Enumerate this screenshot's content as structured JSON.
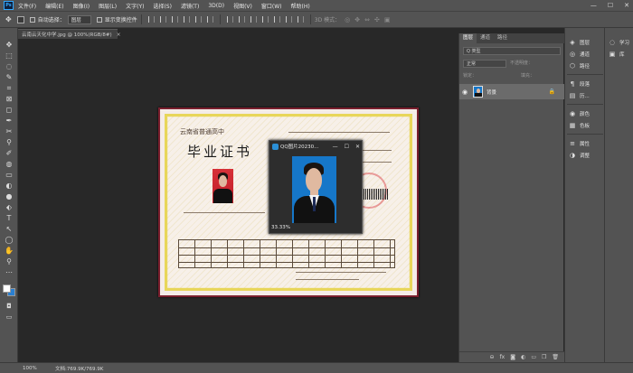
{
  "app": {
    "logo": "Ps"
  },
  "menu": [
    "文件(F)",
    "编辑(E)",
    "图像(I)",
    "图层(L)",
    "文字(Y)",
    "选择(S)",
    "滤镜(T)",
    "3D(D)",
    "视图(V)",
    "窗口(W)",
    "帮助(H)"
  ],
  "window_controls": {
    "minimize": "—",
    "maximize": "☐",
    "close": "✕"
  },
  "options_bar": {
    "auto_select_label": "自动选择：",
    "auto_select_value": "图层",
    "show_transform_label": "显示变换控件",
    "mode_label": "3D 模式："
  },
  "document_tab": {
    "title": "云南云天化中学.jpg @ 100%(RGB/8#)",
    "close": "×"
  },
  "toolbar": {
    "tools": [
      "✥",
      "⬚",
      "◌",
      "✎",
      "⌗",
      "⊠",
      "◻",
      "✒",
      "✂",
      "⚲",
      "✐",
      "◍",
      "▭",
      "◐",
      "●",
      "⬖",
      "T",
      "↖",
      "◯",
      "✋",
      "⚲",
      "⋯"
    ]
  },
  "certificate": {
    "school": "云南省普通高中",
    "title": "毕业证书"
  },
  "viewer": {
    "title": "QQ图片20230...",
    "minimize": "—",
    "maximize": "☐",
    "close": "✕",
    "zoom": "33.33%"
  },
  "layers_panel": {
    "tabs": [
      "图层",
      "通道",
      "路径"
    ],
    "filter_placeholder": "Q 类型",
    "blend_mode": "正常",
    "opacity_label": "不透明度：",
    "lock_label": "锁定：",
    "fill_label": "填充：",
    "layer_name": "背景",
    "footer_icons": [
      "⊖",
      "fx",
      "◙",
      "◐",
      "▭",
      "❐",
      "🗑"
    ]
  },
  "panel_strip": {
    "items": [
      "图层",
      "通道",
      "路径",
      "段落",
      "历...",
      "颜色",
      "色板",
      "属性",
      "调整"
    ],
    "icons": [
      "◈",
      "◎",
      "⬡",
      "¶",
      "▤",
      "◉",
      "▦",
      "≡",
      "◑"
    ]
  },
  "panel_strip2": {
    "items": [
      "学习",
      "库"
    ],
    "icons": [
      "◌",
      "▣"
    ]
  },
  "status_bar": {
    "zoom": "100%",
    "doc": "文档:769.9K/769.9K"
  }
}
